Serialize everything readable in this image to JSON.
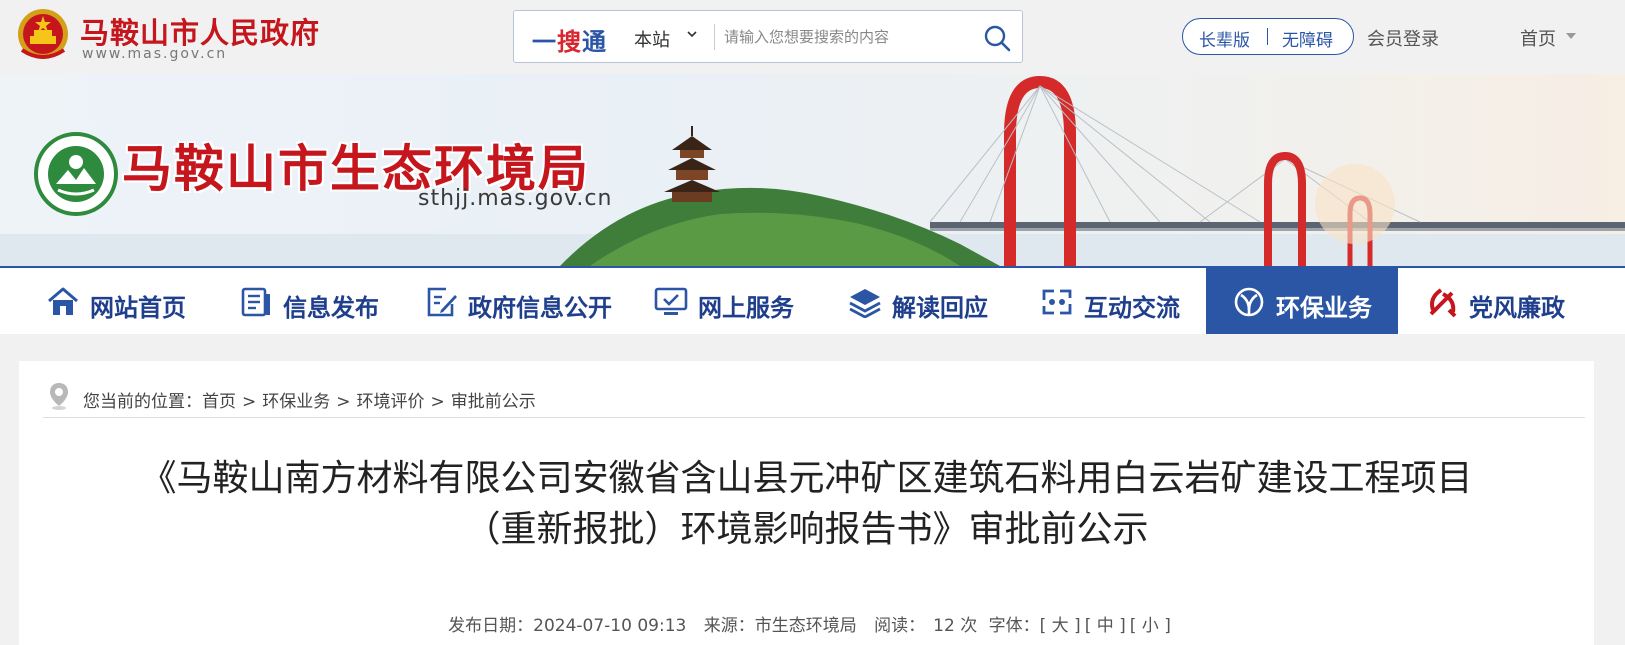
{
  "header": {
    "site_title": "马鞍山市人民政府",
    "site_url": "www.mas.gov.cn",
    "search": {
      "brand_left": "一",
      "brand_mid": "搜",
      "brand_right": "通",
      "scope": "本站",
      "placeholder": "请输入您想要搜索的内容"
    },
    "elder_mode": "长辈版",
    "accessibility": "无障碍",
    "login": "会员登录",
    "home": "首页"
  },
  "banner": {
    "title": "马鞍山市生态环境局",
    "url": "sthjj.mas.gov.cn"
  },
  "nav": {
    "items": [
      {
        "label": "网站首页",
        "icon": "home-icon"
      },
      {
        "label": "信息发布",
        "icon": "document-list-icon"
      },
      {
        "label": "政府信息公开",
        "icon": "edit-document-icon"
      },
      {
        "label": "网上服务",
        "icon": "monitor-check-icon"
      },
      {
        "label": "解读回应",
        "icon": "layers-icon"
      },
      {
        "label": "互动交流",
        "icon": "interaction-icon"
      },
      {
        "label": "环保业务",
        "icon": "eco-leaf-icon"
      },
      {
        "label": "党风廉政",
        "icon": "party-emblem-icon"
      }
    ],
    "active_index": 6
  },
  "breadcrumb": {
    "prefix": "您当前的位置：",
    "items": [
      "首页",
      "环保业务",
      "环境评价",
      "审批前公示"
    ],
    "separator": ">"
  },
  "article": {
    "title_line1": "《马鞍山南方材料有限公司安徽省含山县元冲矿区建筑石料用白云岩矿建设工程项目",
    "title_line2": "（重新报批）环境影响报告书》审批前公示",
    "date_label": "发布日期：",
    "date": "2024-07-10 09:13",
    "source_label": "来源：",
    "source": "市生态环境局",
    "reads_label": "阅读：",
    "reads": "12 次",
    "font_label": "字体：",
    "font_large": "[ 大 ]",
    "font_medium": "[ 中 ]",
    "font_small": "[ 小 ]"
  },
  "colors": {
    "brand_red": "#c4161c",
    "nav_blue": "#2b56a6",
    "nav_text": "#1f3f8c"
  }
}
